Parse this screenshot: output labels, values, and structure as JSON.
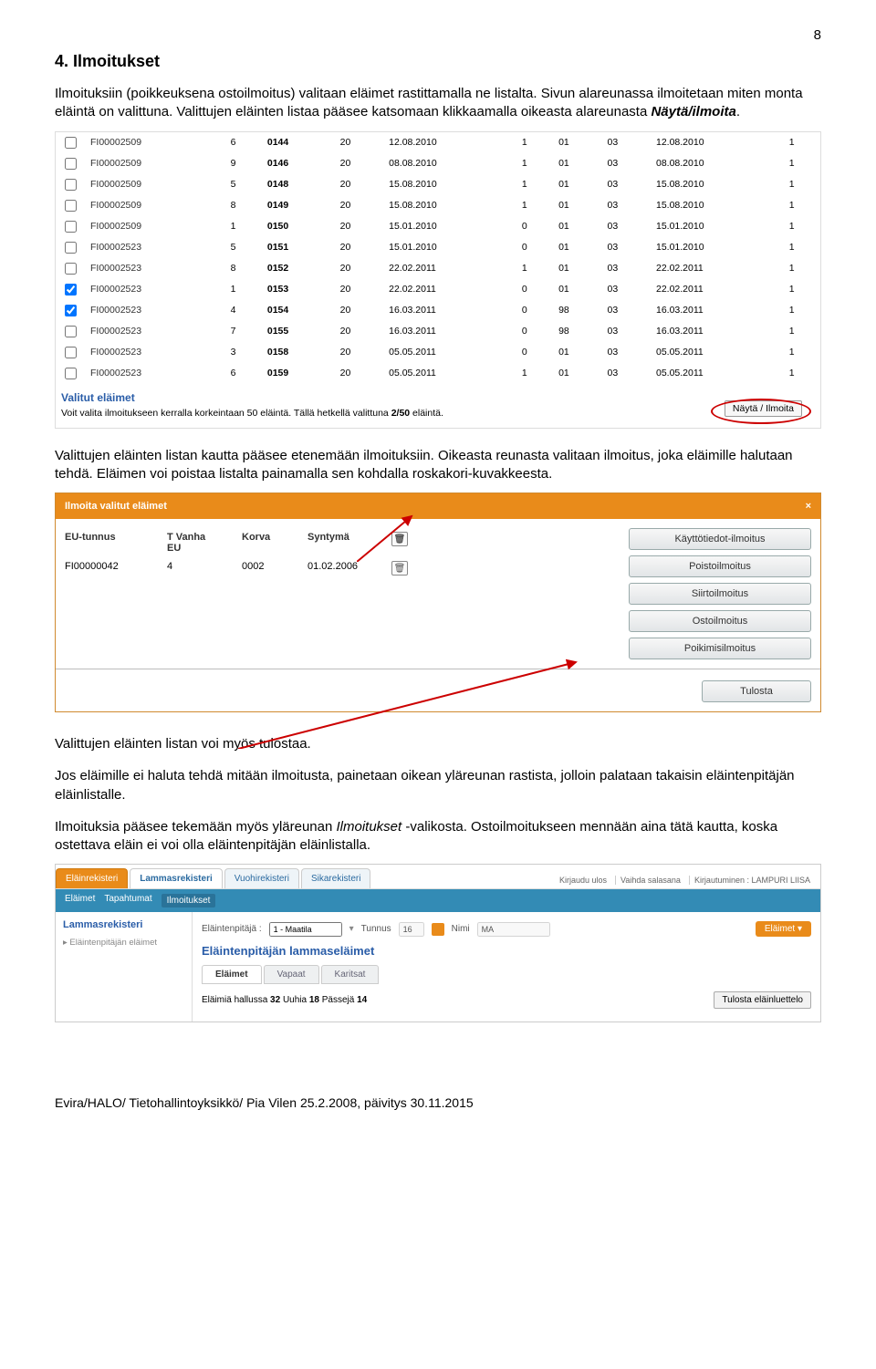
{
  "page_number": "8",
  "heading": "4. Ilmoitukset",
  "para1_a": "Ilmoituksiin (poikkeuksena ostoilmoitus) valitaan eläimet rastittamalla ne listalta. Sivun alareunassa ilmoitetaan miten monta eläintä on valittuna. Valittujen eläinten listaa pääsee katsomaan klikkaamalla oikeasta alareunasta ",
  "para1_b": "Näytä/ilmoita",
  "para1_c": ".",
  "grid_rows": [
    {
      "chk": false,
      "fi": "FI00002509",
      "c3": "6",
      "c4": "0144",
      "c5": "20",
      "c6": "12.08.2010",
      "c7": "1",
      "c8": "01",
      "c9": "03",
      "c10": "12.08.2010",
      "c11": "1"
    },
    {
      "chk": false,
      "fi": "FI00002509",
      "c3": "9",
      "c4": "0146",
      "c5": "20",
      "c6": "08.08.2010",
      "c7": "1",
      "c8": "01",
      "c9": "03",
      "c10": "08.08.2010",
      "c11": "1"
    },
    {
      "chk": false,
      "fi": "FI00002509",
      "c3": "5",
      "c4": "0148",
      "c5": "20",
      "c6": "15.08.2010",
      "c7": "1",
      "c8": "01",
      "c9": "03",
      "c10": "15.08.2010",
      "c11": "1"
    },
    {
      "chk": false,
      "fi": "FI00002509",
      "c3": "8",
      "c4": "0149",
      "c5": "20",
      "c6": "15.08.2010",
      "c7": "1",
      "c8": "01",
      "c9": "03",
      "c10": "15.08.2010",
      "c11": "1"
    },
    {
      "chk": false,
      "fi": "FI00002509",
      "c3": "1",
      "c4": "0150",
      "c5": "20",
      "c6": "15.01.2010",
      "c7": "0",
      "c8": "01",
      "c9": "03",
      "c10": "15.01.2010",
      "c11": "1"
    },
    {
      "chk": false,
      "fi": "FI00002523",
      "c3": "5",
      "c4": "0151",
      "c5": "20",
      "c6": "15.01.2010",
      "c7": "0",
      "c8": "01",
      "c9": "03",
      "c10": "15.01.2010",
      "c11": "1"
    },
    {
      "chk": false,
      "fi": "FI00002523",
      "c3": "8",
      "c4": "0152",
      "c5": "20",
      "c6": "22.02.2011",
      "c7": "1",
      "c8": "01",
      "c9": "03",
      "c10": "22.02.2011",
      "c11": "1"
    },
    {
      "chk": true,
      "fi": "FI00002523",
      "c3": "1",
      "c4": "0153",
      "c5": "20",
      "c6": "22.02.2011",
      "c7": "0",
      "c8": "01",
      "c9": "03",
      "c10": "22.02.2011",
      "c11": "1"
    },
    {
      "chk": true,
      "fi": "FI00002523",
      "c3": "4",
      "c4": "0154",
      "c5": "20",
      "c6": "16.03.2011",
      "c7": "0",
      "c8": "98",
      "c9": "03",
      "c10": "16.03.2011",
      "c11": "1"
    },
    {
      "chk": false,
      "fi": "FI00002523",
      "c3": "7",
      "c4": "0155",
      "c5": "20",
      "c6": "16.03.2011",
      "c7": "0",
      "c8": "98",
      "c9": "03",
      "c10": "16.03.2011",
      "c11": "1"
    },
    {
      "chk": false,
      "fi": "FI00002523",
      "c3": "3",
      "c4": "0158",
      "c5": "20",
      "c6": "05.05.2011",
      "c7": "0",
      "c8": "01",
      "c9": "03",
      "c10": "05.05.2011",
      "c11": "1"
    },
    {
      "chk": false,
      "fi": "FI00002523",
      "c3": "6",
      "c4": "0159",
      "c5": "20",
      "c6": "05.05.2011",
      "c7": "1",
      "c8": "01",
      "c9": "03",
      "c10": "05.05.2011",
      "c11": "1"
    }
  ],
  "selected_header": "Valitut eläimet",
  "selected_sub_a": "Voit valita ilmoitukseen kerralla korkeintaan 50 eläintä. Tällä hetkellä valittuna ",
  "selected_sub_b": "2/50",
  "selected_sub_c": " eläintä.",
  "nayta_button": "Näytä / Ilmoita",
  "para2": "Valittujen eläinten listan kautta pääsee etenemään ilmoituksiin. Oikeasta reunasta valitaan ilmoitus, joka eläimille halutaan tehdä. Eläimen voi poistaa listalta painamalla sen kohdalla roskakori-kuvakkeesta.",
  "dialog": {
    "title": "Ilmoita valitut eläimet",
    "close": "×",
    "headers": {
      "eu": "EU-tunnus",
      "tv": "T Vanha EU",
      "korva": "Korva",
      "synt": "Syntymä"
    },
    "row": {
      "eu": "FI00000042",
      "tv": "4",
      "korva": "0002",
      "synt": "01.02.2006"
    },
    "actions": [
      "Käyttötiedot-ilmoitus",
      "Poistoilmoitus",
      "Siirtoilmoitus",
      "Ostoilmoitus",
      "Poikimisilmoitus"
    ],
    "print": "Tulosta"
  },
  "para3": "Valittujen eläinten listan voi myös tulostaa.",
  "para4": "Jos eläimille ei haluta tehdä mitään ilmoitusta, painetaan oikean yläreunan rastista, jolloin palataan takaisin eläintenpitäjän eläinlistalle.",
  "para5_a": "Ilmoituksia pääsee tekemään myös yläreunan ",
  "para5_b": "Ilmoitukset",
  "para5_c": " -valikosta. Ostoilmoitukseen mennään aina tätä kautta, koska ostettava eläin ei voi olla eläintenpitäjän eläinlistalla.",
  "nav": {
    "tabs": [
      "Eläinrekisteri",
      "Lammasrekisteri",
      "Vuohirekisteri",
      "Sikarekisteri"
    ],
    "links": [
      "Kirjaudu ulos",
      "Vaihda salasana",
      "Kirjautuminen : LAMPURI LIISA"
    ],
    "blue": [
      "Eläimet",
      "Tapahtumat",
      "Ilmoitukset"
    ],
    "sidebar_title": "Lammasrekisteri",
    "sidebar_item": "Eläintenpitäjän eläimet",
    "filter": {
      "pitaja_label": "Eläintenpitäjä :",
      "pitaja_value": "1 - Maatila",
      "tunnus_label": "Tunnus",
      "tunnus_value": "16",
      "nimi_label": "Nimi",
      "nimi_value": "MA",
      "elaimet_btn": "Eläimet"
    },
    "panel_title": "Eläintenpitäjän lammaseläimet",
    "subtabs": [
      "Eläimet",
      "Vapaat",
      "Karitsat"
    ],
    "counts_a": "Eläimiä hallussa ",
    "counts_b": "32",
    "counts_c": "  Uuhia ",
    "counts_d": "18",
    "counts_e": "  Pässejä ",
    "counts_f": "14",
    "print_list": "Tulosta eläinluettelo"
  },
  "footer": "Evira/HALO/ Tietohallintoyksikkö/ Pia Vilen 25.2.2008, päivitys 30.11.2015"
}
